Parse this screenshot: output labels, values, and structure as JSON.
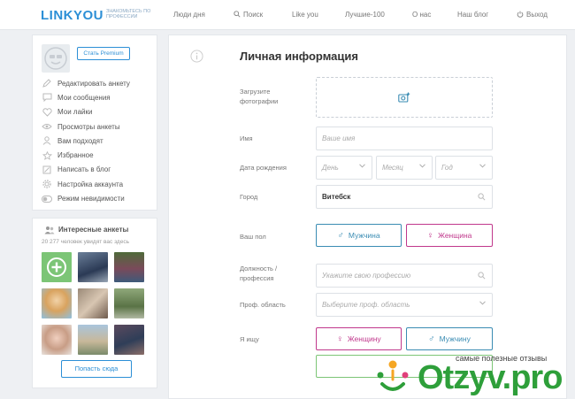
{
  "header": {
    "logo": "LINKYOU",
    "logo_sub": "ЗНАКОМЬТЕСЬ ПО ПРОФЕССИИ",
    "nav": {
      "people": "Люди дня",
      "search": "Поиск",
      "likeyou": "Like you",
      "best": "Лучшие-100",
      "about": "О нас",
      "blog": "Наш блог",
      "exit": "Выход"
    }
  },
  "sidebar": {
    "premium_label": "Стать Premium",
    "menu": {
      "edit": "Редактировать анкету",
      "messages": "Мои сообщения",
      "likes": "Мои лайки",
      "views": "Просмотры анкеты",
      "match": "Вам подходят",
      "favorites": "Избранное",
      "blog": "Написать в блог",
      "settings": "Настройка аккаунта",
      "invisible": "Режим невидимости"
    }
  },
  "interesting": {
    "title": "Интересные анкеты",
    "subtitle": "20 277 человек увидят вас здесь",
    "button": "Попасть сюда"
  },
  "form": {
    "title": "Личная информация",
    "photo_label": "Загрузите фотографии",
    "name_label": "Имя",
    "name_placeholder": "Ваше имя",
    "birth_label": "Дата рождения",
    "day_placeholder": "День",
    "month_placeholder": "Месяц",
    "year_placeholder": "Год",
    "city_label": "Город",
    "city_value": "Витебск",
    "gender_label": "Ваш пол",
    "male": "Мужчина",
    "female": "Женщина",
    "position_label": "Должность / профессия",
    "position_placeholder": "Укажите свою профессию",
    "area_label": "Проф. область",
    "area_placeholder": "Выберите проф. область",
    "seek_label": "Я ищу",
    "seek_female": "Женщину",
    "seek_male": "Мужчину"
  },
  "watermark": {
    "tagline": "самые полезные отзывы",
    "brand": "Otzyv.pro"
  },
  "colors": {
    "brand": "#2c8fd6",
    "male": "#3a8cb3",
    "female": "#c0388c",
    "add": "#7cc576",
    "watermark": "#2e9f3a"
  }
}
